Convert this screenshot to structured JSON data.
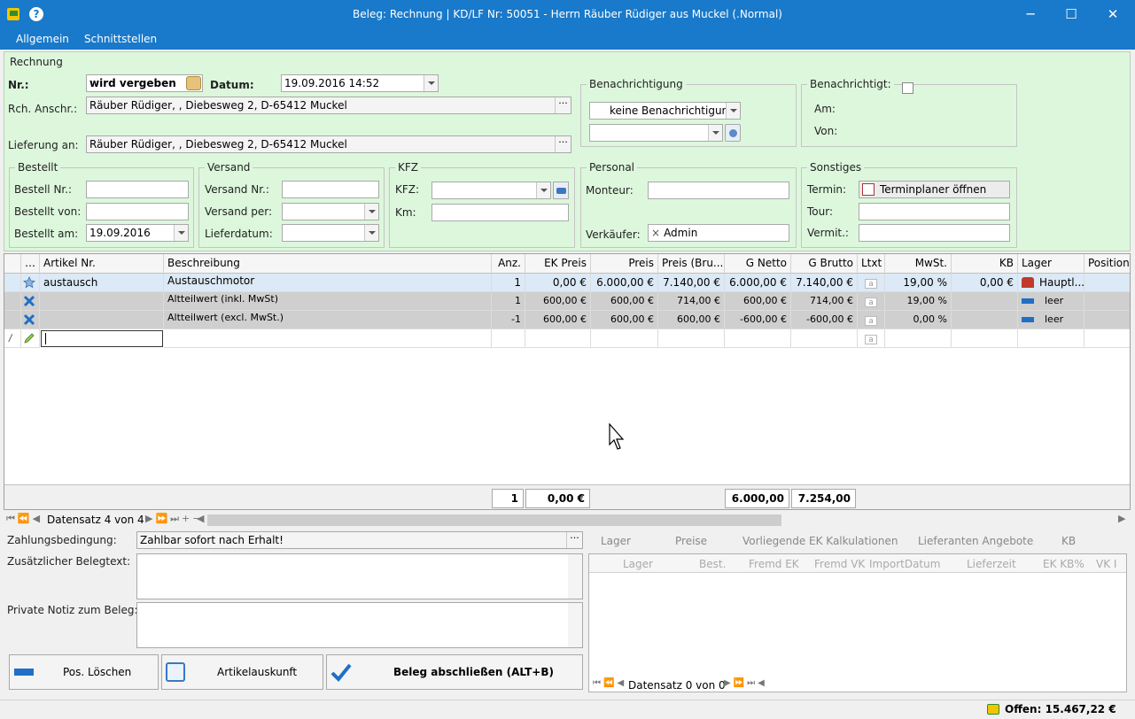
{
  "window": {
    "title": "Beleg: Rechnung |  KD/LF Nr: 50051 - Herrn Räuber Rüdiger aus Muckel (.Normal)",
    "minimize": "─",
    "maximize": "☐",
    "close": "✕"
  },
  "menu": {
    "allgemein": "Allgemein",
    "schnittstellen": "Schnittstellen"
  },
  "rechnung": {
    "group_title": "Rechnung",
    "nr_label": "Nr.:",
    "nr_value": "wird vergeben",
    "datum_label": "Datum:",
    "datum_value": "19.09.2016 14:52",
    "rch_label": "Rch. Anschr.:",
    "rch_value": "Räuber Rüdiger, , Diebesweg 2, D-65412 Muckel",
    "lief_label": "Lieferung an:",
    "lief_value": "Räuber Rüdiger, , Diebesweg 2, D-65412 Muckel",
    "ellipsis": "···"
  },
  "benachrichtigung": {
    "title": "Benachrichtigung",
    "value": "keine Benachrichtigung",
    "value2": ""
  },
  "benachrichtigt": {
    "title": "Benachrichtigt:",
    "am_label": "Am:",
    "von_label": "Von:"
  },
  "bestellt": {
    "title": "Bestellt",
    "nr_label": "Bestell Nr.:",
    "nr_value": "",
    "von_label": "Bestellt von:",
    "von_value": "",
    "am_label": "Bestellt am:",
    "am_value": "19.09.2016"
  },
  "versand": {
    "title": "Versand",
    "nr_label": "Versand Nr.:",
    "nr_value": "",
    "per_label": "Versand per:",
    "per_value": "",
    "lief_label": "Lieferdatum:",
    "lief_value": ""
  },
  "kfz": {
    "title": "KFZ",
    "kfz_label": "KFZ:",
    "kfz_value": "",
    "km_label": "Km:",
    "km_value": ""
  },
  "personal": {
    "title": "Personal",
    "monteur_label": "Monteur:",
    "monteur_value": "",
    "verk_label": "Verkäufer:",
    "verk_value": "Admin",
    "verk_x": "×"
  },
  "sonstiges": {
    "title": "Sonstiges",
    "termin_label": "Termin:",
    "termin_button": "Terminplaner öffnen",
    "tour_label": "Tour:",
    "tour_value": "",
    "vermit_label": "Vermit.:",
    "vermit_value": ""
  },
  "grid": {
    "headers": [
      "…",
      "Artikel Nr.",
      "Beschreibung",
      "Anz.",
      "EK Preis",
      "Preis",
      "Preis (Bru...",
      "G Netto",
      "G Brutto",
      "Ltxt",
      "MwSt.",
      "KB",
      "Lager",
      "Position"
    ],
    "rows": [
      {
        "artikel": "austausch",
        "beschreibung": "Austauschmotor",
        "anz": "1",
        "ek": "0,00 €",
        "preis": "6.000,00 €",
        "brutto": "7.140,00 €",
        "gnetto": "6.000,00 €",
        "gbrutto": "7.140,00 €",
        "mwst": "19,00 %",
        "kb": "0,00 €",
        "lager": "Hauptl..."
      },
      {
        "artikel": "",
        "beschreibung": "Altteilwert (inkl. MwSt)",
        "anz": "1",
        "ek": "600,00 €",
        "preis": "600,00 €",
        "brutto": "714,00 €",
        "gnetto": "600,00 €",
        "gbrutto": "714,00 €",
        "mwst": "19,00 %",
        "kb": "",
        "lager": "leer"
      },
      {
        "artikel": "",
        "beschreibung": "Altteilwert (excl. MwSt.)",
        "anz": "-1",
        "ek": "600,00 €",
        "preis": "600,00 €",
        "brutto": "600,00 €",
        "gnetto": "-600,00 €",
        "gbrutto": "-600,00 €",
        "mwst": "0,00 %",
        "kb": "",
        "lager": "leer"
      }
    ],
    "ltxt": "a",
    "totals": {
      "anz": "1",
      "ek": "0,00 €",
      "gnetto": "6.000,00 €",
      "gbrutto": "7.254,00 €"
    }
  },
  "nav": {
    "record": "Datensatz 4 von 4"
  },
  "bottom": {
    "zahlung_label": "Zahlungsbedingung:",
    "zahlung_value": "Zahlbar sofort nach Erhalt!",
    "zusatz_label": "Zusätzlicher Belegtext:",
    "notiz_label": "Private Notiz zum Beleg:",
    "pos_loeschen": "Pos. Löschen",
    "artikelauskunft": "Artikelauskunft",
    "abschliessen": "Beleg abschließen (ALT+B)"
  },
  "side": {
    "tabs": [
      "Lager",
      "Preise",
      "Vorliegende EK Kalkulationen",
      "Lieferanten Angebote",
      "KB"
    ],
    "headers": [
      "Lager",
      "Best.",
      "Fremd EK",
      "Fremd VK",
      "ImportDatum",
      "Lieferzeit",
      "EK KB%",
      "VK I"
    ],
    "record": "Datensatz 0 von 0"
  },
  "status": {
    "offen": "Offen: 15.467,22 €"
  }
}
